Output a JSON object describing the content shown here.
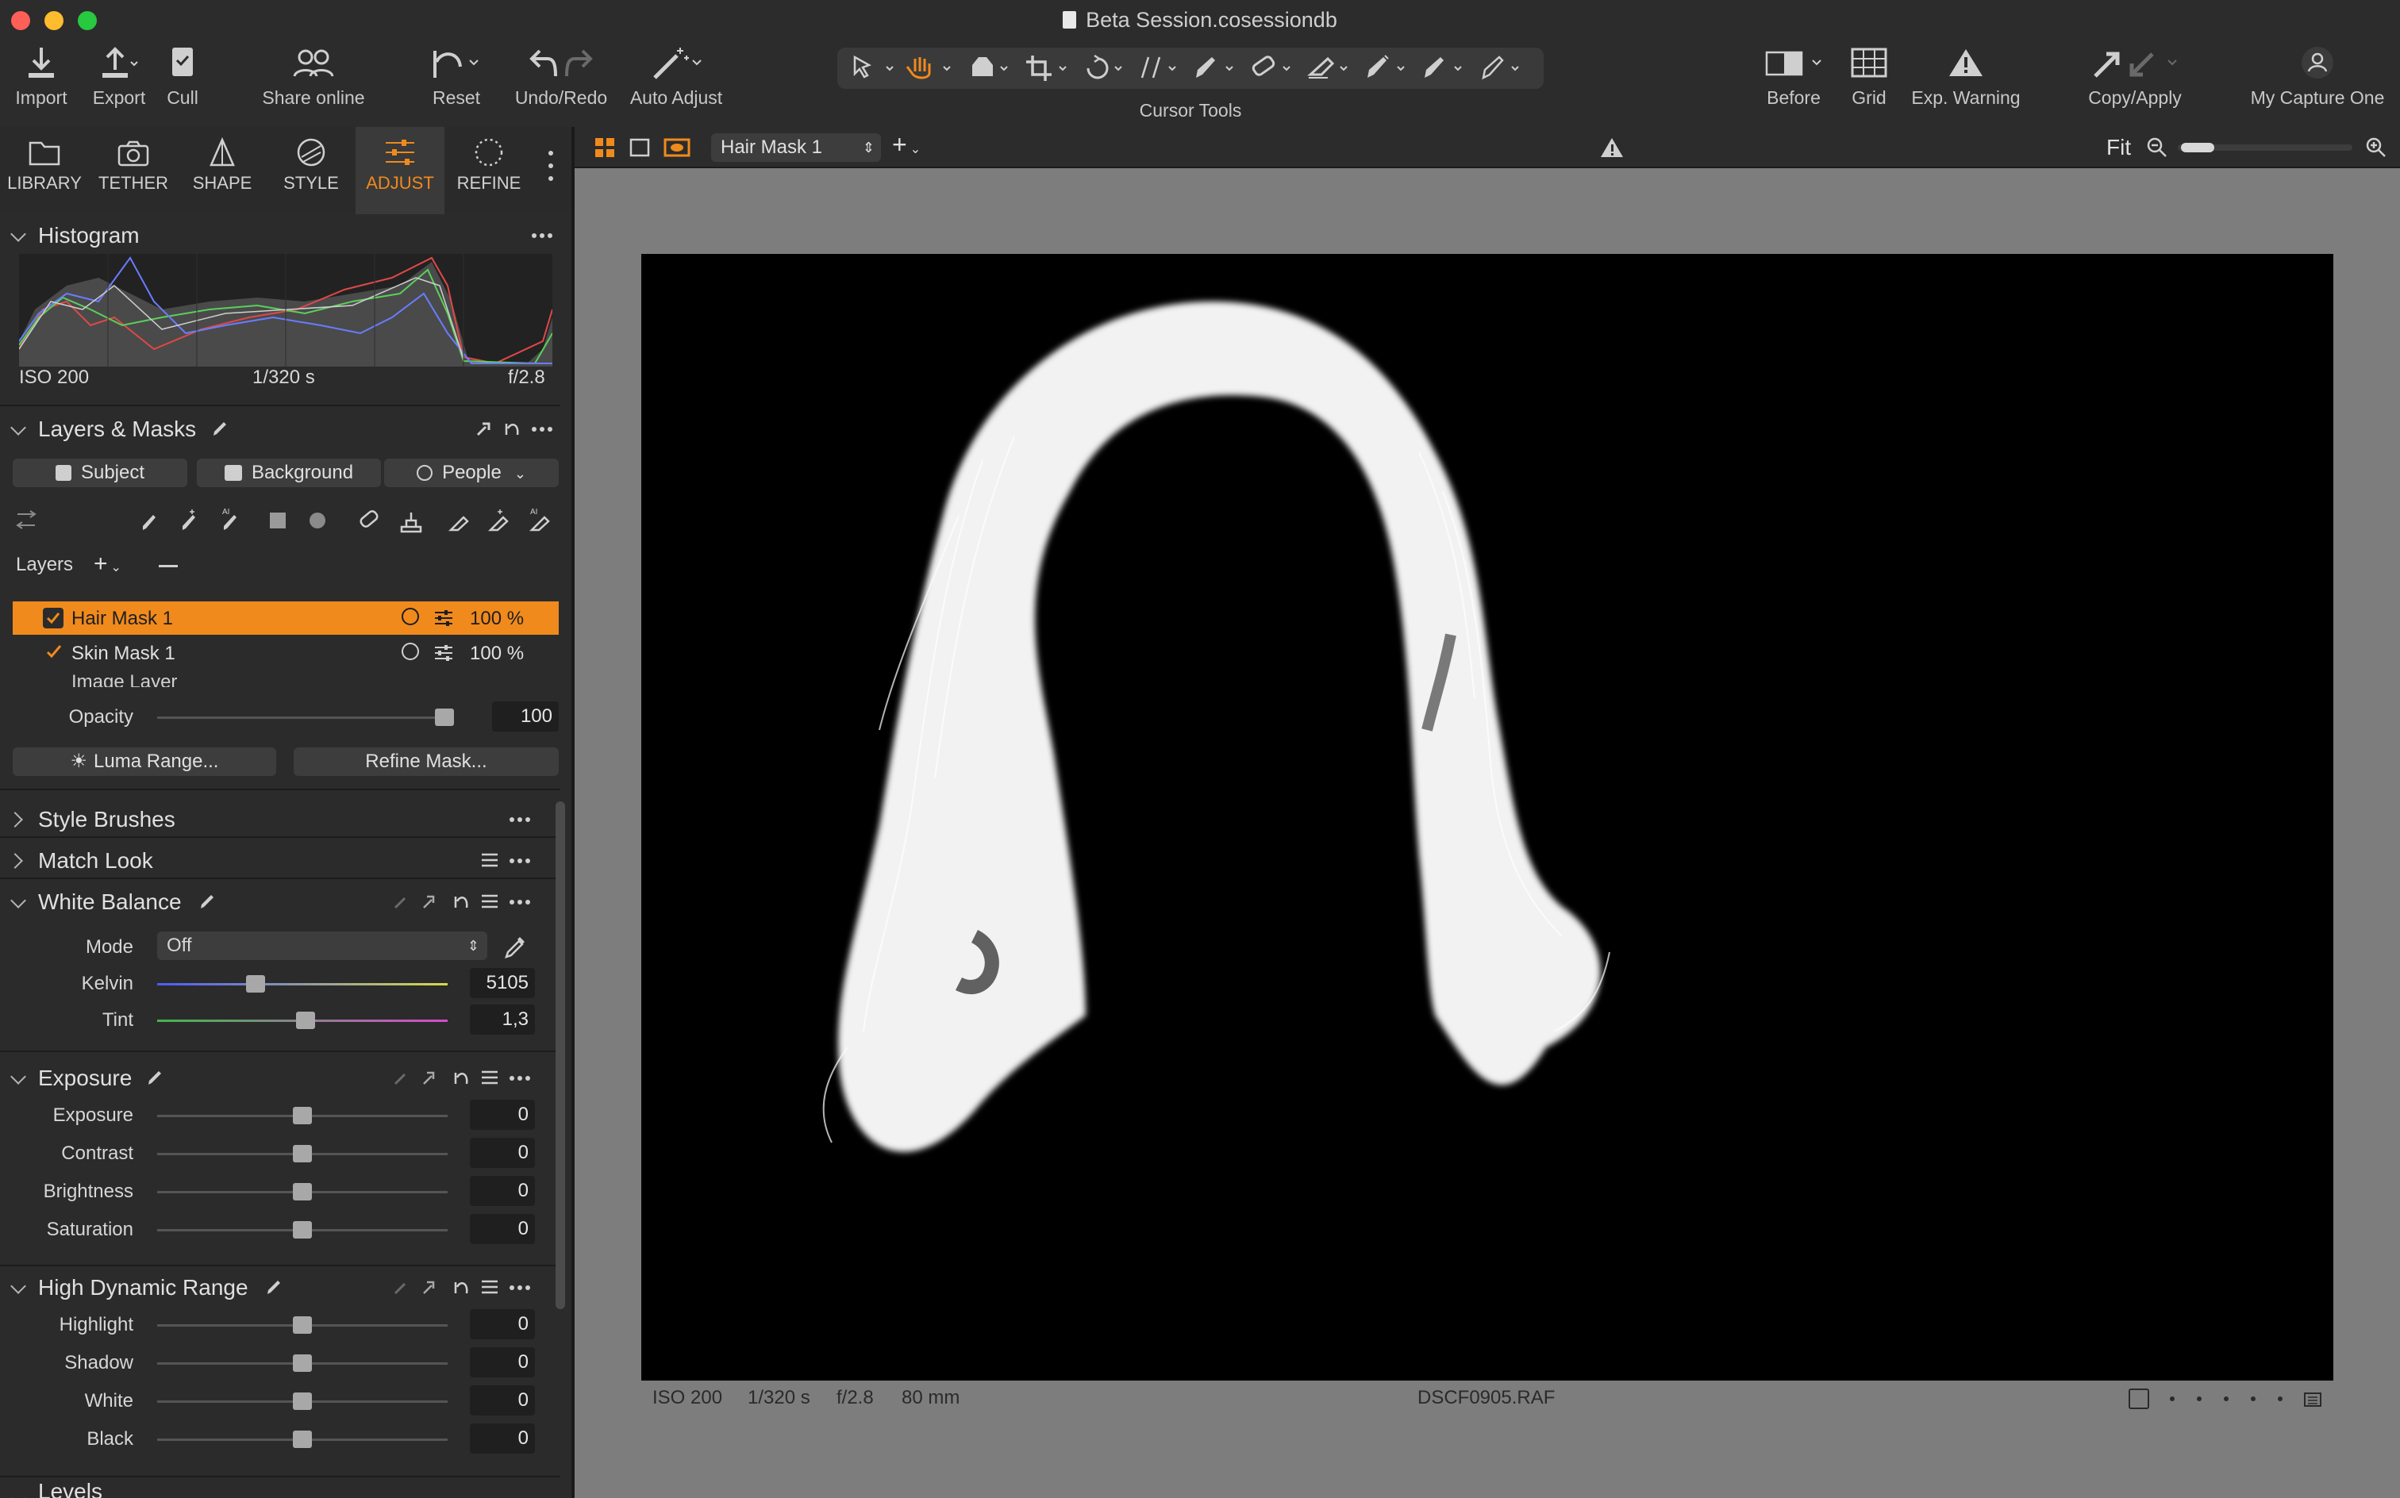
{
  "window": {
    "title": "Beta Session.cosessiondb"
  },
  "toolbar": {
    "import": "Import",
    "export": "Export",
    "cull": "Cull",
    "share": "Share online",
    "reset": "Reset",
    "undo_redo": "Undo/Redo",
    "auto_adjust": "Auto Adjust",
    "cursor_tools": "Cursor Tools",
    "before": "Before",
    "grid": "Grid",
    "exp_warning": "Exp. Warning",
    "copy_apply": "Copy/Apply",
    "my_capture_one": "My Capture One"
  },
  "tabs": [
    {
      "label": "LIBRARY"
    },
    {
      "label": "TETHER"
    },
    {
      "label": "SHAPE"
    },
    {
      "label": "STYLE"
    },
    {
      "label": "ADJUST"
    },
    {
      "label": "REFINE"
    }
  ],
  "histogram": {
    "title": "Histogram",
    "iso": "ISO 200",
    "shutter": "1/320 s",
    "aperture": "f/2.8"
  },
  "layers_masks": {
    "title": "Layers & Masks",
    "subject": "Subject",
    "background": "Background",
    "people": "People",
    "layers_label": "Layers",
    "rows": [
      {
        "name": "Hair Mask 1",
        "opacity": "100 %"
      },
      {
        "name": "Skin Mask 1",
        "opacity": "100 %"
      },
      {
        "name": "Image Layer"
      }
    ],
    "opacity_label": "Opacity",
    "opacity_value": "100",
    "opacity_fraction": 0.99,
    "luma_range": "Luma Range...",
    "refine_mask": "Refine Mask..."
  },
  "sections": {
    "style_brushes": "Style Brushes",
    "match_look": "Match Look",
    "white_balance": "White Balance",
    "exposure": "Exposure",
    "hdr": "High Dynamic Range",
    "levels": "Levels"
  },
  "white_balance": {
    "mode_label": "Mode",
    "mode_value": "Off",
    "kelvin_label": "Kelvin",
    "kelvin_value": "5105",
    "kelvin_fraction": 0.34,
    "tint_label": "Tint",
    "tint_value": "1,3",
    "tint_fraction": 0.51
  },
  "exposure_sliders": [
    {
      "label": "Exposure",
      "value": "0",
      "fraction": 0.5
    },
    {
      "label": "Contrast",
      "value": "0",
      "fraction": 0.5
    },
    {
      "label": "Brightness",
      "value": "0",
      "fraction": 0.5
    },
    {
      "label": "Saturation",
      "value": "0",
      "fraction": 0.5
    }
  ],
  "hdr_sliders": [
    {
      "label": "Highlight",
      "value": "0",
      "fraction": 0.5
    },
    {
      "label": "Shadow",
      "value": "0",
      "fraction": 0.5
    },
    {
      "label": "White",
      "value": "0",
      "fraction": 0.5
    },
    {
      "label": "Black",
      "value": "0",
      "fraction": 0.5
    }
  ],
  "viewer": {
    "variant": "Hair Mask 1",
    "zoom": "Fit",
    "iso": "ISO 200",
    "shutter": "1/320 s",
    "aperture": "f/2.8",
    "focal": "80 mm",
    "filename": "DSCF0905.RAF"
  },
  "colors": {
    "accent": "#f08a1d",
    "close": "#fe5f57",
    "minimize": "#febc2e",
    "zoom": "#28c840"
  }
}
